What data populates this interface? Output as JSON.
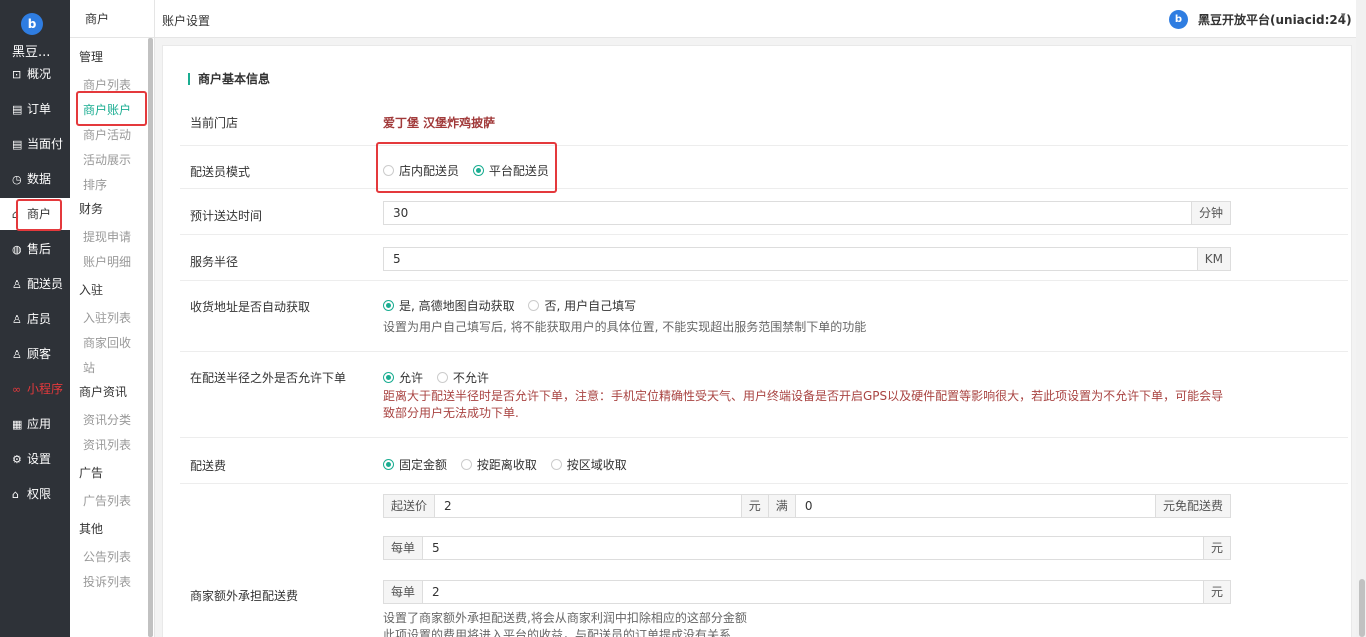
{
  "brand": {
    "shop_short": "黑豆..."
  },
  "nav": [
    {
      "icon": "⊡",
      "label": "概况"
    },
    {
      "icon": "▤",
      "label": "订单"
    },
    {
      "icon": "▤",
      "label": "当面付"
    },
    {
      "icon": "◷",
      "label": "数据"
    },
    {
      "icon": "⌂",
      "label": "商户"
    },
    {
      "icon": "◍",
      "label": "售后"
    },
    {
      "icon": "♙",
      "label": "配送员"
    },
    {
      "icon": "♙",
      "label": "店员"
    },
    {
      "icon": "♙",
      "label": "顾客"
    },
    {
      "icon": "∞",
      "label": "小程序"
    },
    {
      "icon": "▦",
      "label": "应用"
    },
    {
      "icon": "⚙",
      "label": "设置"
    },
    {
      "icon": "⌂",
      "label": "权限"
    }
  ],
  "subnav": {
    "title": "商户",
    "groups": {
      "g1": "管理",
      "g2": "财务",
      "g3": "入驻",
      "g4": "商户资讯",
      "g5": "广告",
      "g6": "其他"
    },
    "links": {
      "l1": "商户列表",
      "l2": "商户账户",
      "l3": "商户活动",
      "l4": "活动展示",
      "l5": "排序",
      "l6": "提现申请",
      "l7": "账户明细",
      "l8": "入驻列表",
      "l9": "商家回收",
      "l10": "站",
      "l11": "资讯分类",
      "l12": "资讯列表",
      "l13": "广告列表",
      "l14": "公告列表",
      "l15": "投诉列表"
    }
  },
  "header": {
    "breadcrumb": "账户设置",
    "platform": "黑豆开放平台(uniacid:24)",
    "caret": "▾",
    "logo": "b"
  },
  "form": {
    "section_title": "商户基本信息",
    "current_store": {
      "label": "当前门店",
      "value": "爱丁堡 汉堡炸鸡披萨"
    },
    "courier_mode": {
      "label": "配送员模式",
      "options": [
        "店内配送员",
        "平台配送员"
      ],
      "selected": 1
    },
    "eta": {
      "label": "预计送达时间",
      "value": "30",
      "unit": "分钟"
    },
    "radius": {
      "label": "服务半径",
      "value": "5",
      "unit": "KM"
    },
    "auto_address": {
      "label": "收货地址是否自动获取",
      "options": [
        "是, 高德地图自动获取",
        "否, 用户自己填写"
      ],
      "selected": 0,
      "help": "设置为用户自己填写后, 将不能获取用户的具体位置, 不能实现超出服务范围禁制下单的功能"
    },
    "out_of_range": {
      "label": "在配送半径之外是否允许下单",
      "options": [
        "允许",
        "不允许"
      ],
      "selected": 0,
      "warning": "距离大于配送半径时是否允许下单，注意：手机定位精确性受天气、用户终端设备是否开启GPS以及硬件配置等影响很大，若此项设置为不允许下单，可能会导致部分用户无法成功下单."
    },
    "delivery_fee": {
      "label": "配送费",
      "options": [
        "固定金额",
        "按距离收取",
        "按区域收取"
      ],
      "selected": 0,
      "start_label": "起送价",
      "start_value": "2",
      "yuan": "元",
      "full_label": "满",
      "full_value": "0",
      "free_label": "元免配送费",
      "per_label": "每单",
      "per_value": "5",
      "per_unit": "元"
    },
    "extra_fee": {
      "label": "商家额外承担配送费",
      "per_label": "每单",
      "value": "2",
      "unit": "元",
      "help1": "设置了商家额外承担配送费,将会从商家利润中扣除相应的这部分金额",
      "help2": "此项设置的费用将进入平台的收益，与配送员的订单提成没有关系"
    }
  }
}
